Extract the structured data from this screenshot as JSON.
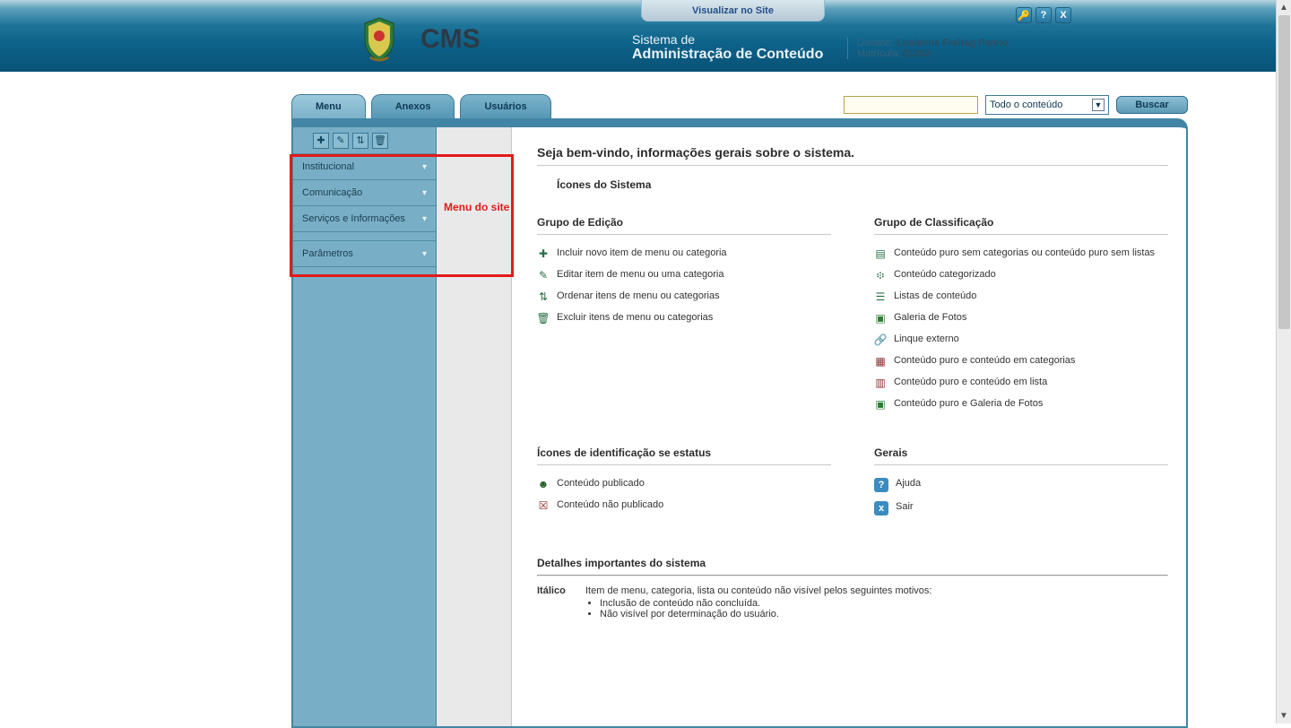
{
  "header": {
    "view_site_label": "Visualizar no Site",
    "cms_label": "CMS",
    "subtitle_l1": "Sistema de",
    "subtitle_l2": "Administração de Conteúdo",
    "user_label": "Usuário:",
    "user_name": "Lucienne Freitag Panno",
    "matricula_label": "Matrícula:",
    "matricula_value": "51292"
  },
  "tabs": [
    {
      "label": "Menu",
      "active": true
    },
    {
      "label": "Anexos",
      "active": false
    },
    {
      "label": "Usuários",
      "active": false
    }
  ],
  "search": {
    "scope": "Todo o conteúdo",
    "button": "Buscar"
  },
  "sidebar": {
    "items": [
      "Institucional",
      "Comunicação",
      "Serviços e Informações",
      "Parâmetros"
    ],
    "annotation": "Menu do site"
  },
  "main": {
    "welcome": "Seja bem-vindo, informações gerais sobre o sistema.",
    "section1_title": "Ícones do Sistema",
    "group_edit": {
      "title": "Grupo de Edição",
      "items": [
        "Incluir novo item de menu ou categoria",
        "Editar item de menu ou uma categoria",
        "Ordenar itens de menu ou categorias",
        "Excluir itens de menu ou categorias"
      ]
    },
    "group_class": {
      "title": "Grupo de Classificação",
      "items": [
        "Conteúdo puro sem categorias ou conteúdo puro sem listas",
        "Conteúdo categorizado",
        "Listas de conteúdo",
        "Galeria de Fotos",
        "Linque externo",
        "Conteúdo puro e conteúdo em categorias",
        "Conteúdo puro e conteúdo em lista",
        "Conteúdo puro e Galeria de Fotos"
      ]
    },
    "status": {
      "title": "Ícones de identificação se estatus",
      "items": [
        "Conteúdo publicado",
        "Conteúdo não publicado"
      ]
    },
    "gerais": {
      "title": "Gerais",
      "items": [
        "Ajuda",
        "Sair"
      ]
    },
    "details": {
      "title": "Detalhes importantes do sistema",
      "italic_label": "Itálico",
      "italic_desc": "Item de menu, categoria, lista ou conteúdo não visível pelos seguintes motivos:",
      "bullets": [
        "Inclusão de conteúdo não concluída.",
        "Não visível por determinação do usuário."
      ]
    }
  }
}
